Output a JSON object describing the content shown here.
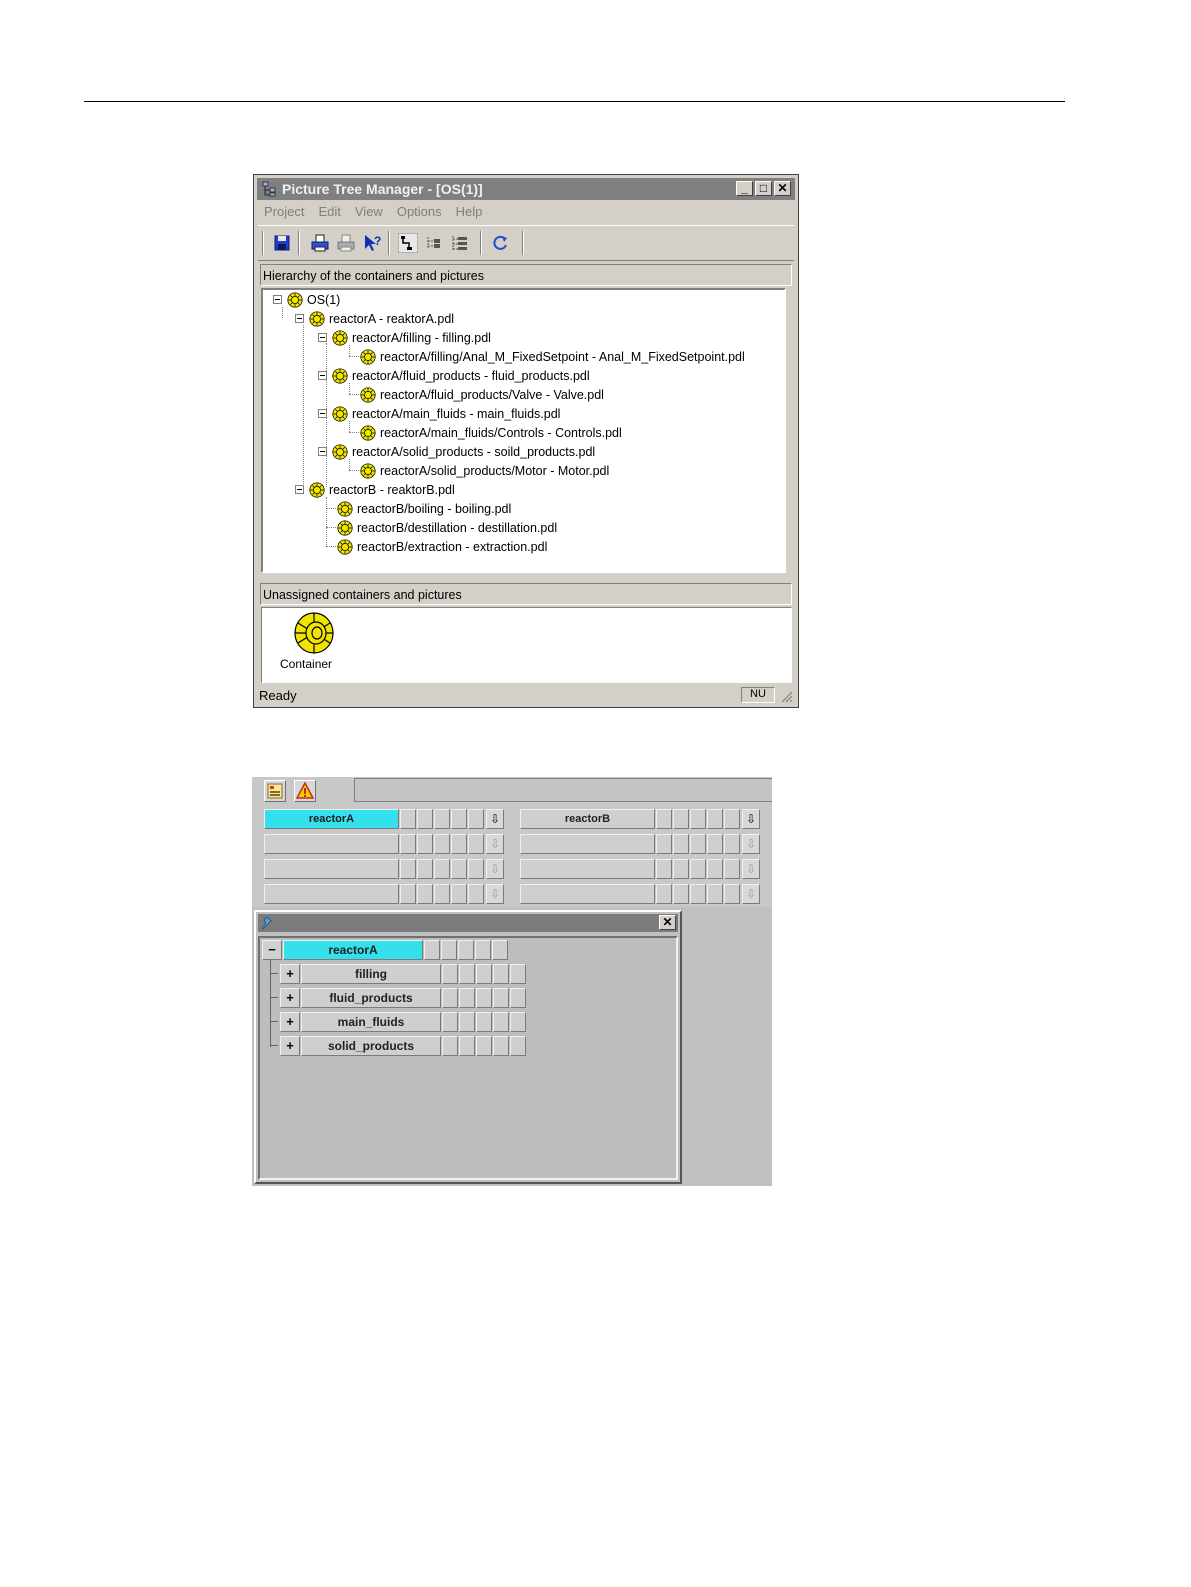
{
  "window": {
    "title": "Picture Tree Manager - [OS(1)]",
    "controls": {
      "minimize": "_",
      "maximize": "□",
      "close": "✕"
    }
  },
  "menu": [
    "Project",
    "Edit",
    "View",
    "Options",
    "Help"
  ],
  "toolbar_icons": [
    "save-icon",
    "print-icon",
    "print-setup-icon",
    "context-help-icon",
    "tree-view-1-icon",
    "tree-view-2-icon",
    "tree-view-3-icon",
    "refresh-icon"
  ],
  "hierarchy": {
    "header": "Hierarchy of the containers and pictures",
    "nodes": [
      {
        "label": "OS(1)",
        "level": 0,
        "expanded": true
      },
      {
        "label": "reactorA - reaktorA.pdl",
        "level": 1,
        "expanded": true
      },
      {
        "label": "reactorA/filling - filling.pdl",
        "level": 2,
        "expanded": true
      },
      {
        "label": "reactorA/filling/Anal_M_FixedSetpoint - Anal_M_FixedSetpoint.pdl",
        "level": 3
      },
      {
        "label": "reactorA/fluid_products - fluid_products.pdl",
        "level": 2,
        "expanded": true
      },
      {
        "label": "reactorA/fluid_products/Valve - Valve.pdl",
        "level": 3
      },
      {
        "label": "reactorA/main_fluids - main_fluids.pdl",
        "level": 2,
        "expanded": true
      },
      {
        "label": "reactorA/main_fluids/Controls - Controls.pdl",
        "level": 3
      },
      {
        "label": "reactorA/solid_products - soild_products.pdl",
        "level": 2,
        "expanded": true
      },
      {
        "label": "reactorA/solid_products/Motor - Motor.pdl",
        "level": 3
      },
      {
        "label": "reactorB - reaktorB.pdl",
        "level": 1,
        "expanded": true
      },
      {
        "label": "reactorB/boiling - boiling.pdl",
        "level": 2
      },
      {
        "label": "reactorB/destillation - destillation.pdl",
        "level": 2
      },
      {
        "label": "reactorB/extraction - extraction.pdl",
        "level": 2
      }
    ]
  },
  "unassigned": {
    "header": "Unassigned containers and pictures",
    "item_label": "Container"
  },
  "status": {
    "text": "Ready",
    "indicator": "NU"
  },
  "runtime": {
    "nav_rows": [
      {
        "left": "reactorA",
        "right": "reactorB"
      },
      {
        "left": "",
        "right": ""
      },
      {
        "left": "",
        "right": ""
      },
      {
        "left": "",
        "right": ""
      }
    ],
    "arrow": "⇩",
    "tree_window": {
      "close": "✕",
      "root": {
        "sign": "−",
        "label": "reactorA"
      },
      "children": [
        {
          "sign": "+",
          "label": "filling"
        },
        {
          "sign": "+",
          "label": "fluid_products"
        },
        {
          "sign": "+",
          "label": "main_fluids"
        },
        {
          "sign": "+",
          "label": "solid_products"
        }
      ]
    }
  },
  "colors": {
    "active_button": "#33e0ec",
    "container_icon": "#f0e400"
  }
}
